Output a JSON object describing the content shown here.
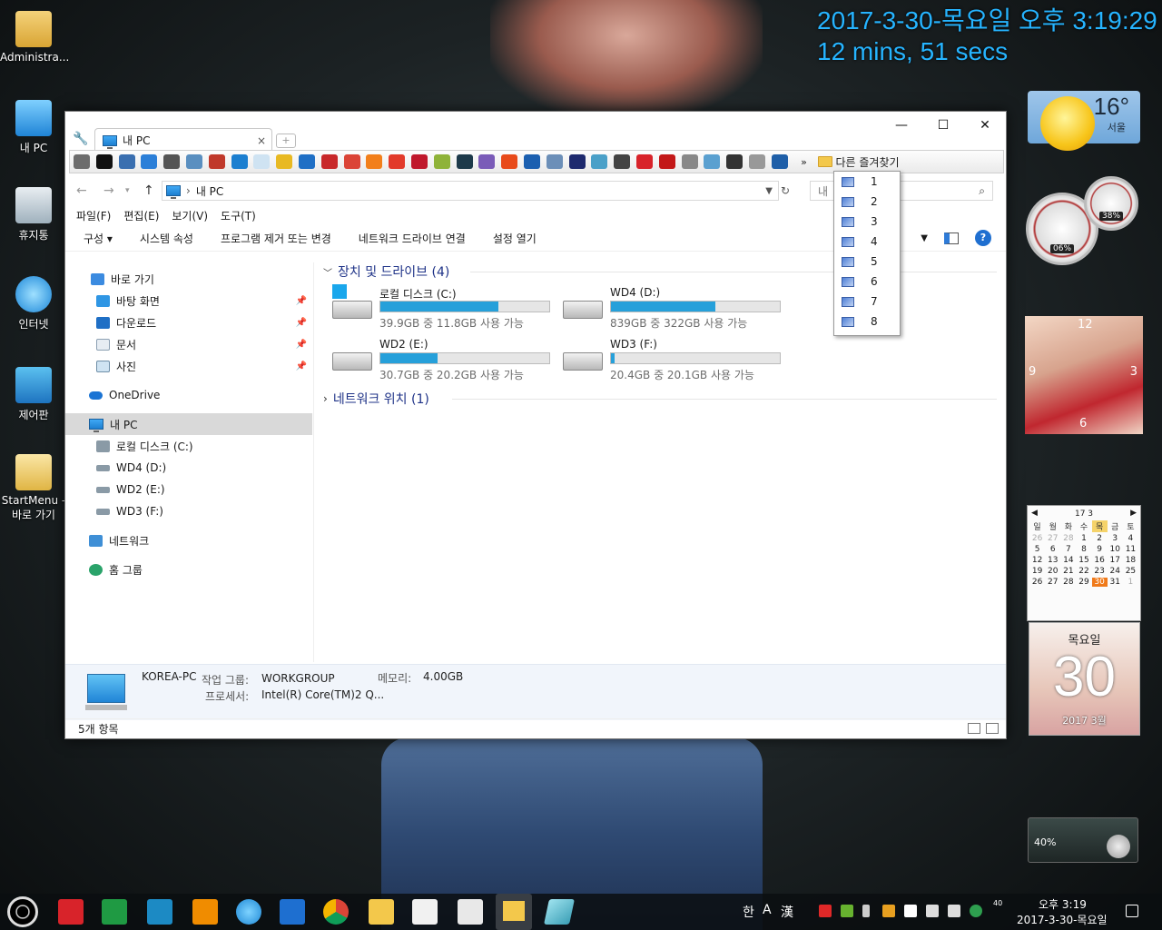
{
  "desktop": {
    "icons": [
      {
        "label": "Administra..."
      },
      {
        "label": "내 PC"
      },
      {
        "label": "휴지통"
      },
      {
        "label": "인터넷"
      },
      {
        "label": "제어판"
      },
      {
        "label": "StartMenu -"
      },
      {
        "label": "바로 가기"
      }
    ],
    "clock_line1": "2017-3-30-목요일 오후 3:19:29",
    "clock_line2": "12 mins, 51 secs"
  },
  "gadgets": {
    "weather": {
      "temp": "16°",
      "city": "서울"
    },
    "meters": {
      "cpu": "06%",
      "ram": "38%"
    },
    "photo_clock": {
      "n12": "12",
      "n3": "3",
      "n6": "6",
      "n9": "9"
    },
    "calendar": {
      "header": "17 3",
      "prev": "◀",
      "next": "▶",
      "weekdays": [
        "일",
        "월",
        "화",
        "수",
        "목",
        "금",
        "토"
      ],
      "days": [
        "26",
        "27",
        "28",
        "1",
        "2",
        "3",
        "4",
        "5",
        "6",
        "7",
        "8",
        "9",
        "10",
        "11",
        "12",
        "13",
        "14",
        "15",
        "16",
        "17",
        "18",
        "19",
        "20",
        "21",
        "22",
        "23",
        "24",
        "25",
        "26",
        "27",
        "28",
        "29",
        "30",
        "31",
        "1"
      ],
      "today": "30"
    },
    "date_card": {
      "weekday": "목요일",
      "day": "30",
      "yearmonth": "2017 3월"
    },
    "volume": {
      "percent": "40%"
    }
  },
  "window": {
    "tab_title": "내 PC",
    "tab_close": "×",
    "new_tab": "+",
    "controls": {
      "minimize": "—",
      "maximize": "☐",
      "close": "✕"
    },
    "overflow": "»",
    "favorites": "다른 즐겨찾기",
    "address": {
      "path": "내 PC",
      "search_placeholder": "내"
    },
    "menu": [
      "파일(F)",
      "편집(E)",
      "보기(V)",
      "도구(T)"
    ],
    "commands": [
      "구성 ▾",
      "시스템 속성",
      "프로그램 제거 또는 변경",
      "네트워크 드라이브 연결",
      "설정 열기"
    ],
    "nav": {
      "quick_access": "바로 가기",
      "desktop": "바탕 화면",
      "downloads": "다운로드",
      "documents": "문서",
      "pictures": "사진",
      "onedrive": "OneDrive",
      "this_pc": "내 PC",
      "drive_c": "로컬 디스크 (C:)",
      "drive_d": "WD4 (D:)",
      "drive_e": "WD2 (E:)",
      "drive_f": "WD3 (F:)",
      "network": "네트워크",
      "homegroup": "홈 그룹"
    },
    "content": {
      "devices_header": "장치 및 드라이브 (4)",
      "network_header": "네트워크 위치 (1)",
      "drives": [
        {
          "name": "로컬 디스크 (C:)",
          "free": "39.9GB 중 11.8GB 사용 가능",
          "used_fraction": 0.7
        },
        {
          "name": "WD4 (D:)",
          "free": "839GB 중 322GB 사용 가능",
          "used_fraction": 0.62
        },
        {
          "name": "WD2 (E:)",
          "free": "30.7GB 중 20.2GB 사용 가능",
          "used_fraction": 0.34
        },
        {
          "name": "WD3 (F:)",
          "free": "20.4GB 중 20.1GB 사용 가능",
          "used_fraction": 0.02
        }
      ]
    },
    "details": {
      "pc_name": "KOREA-PC",
      "workgroup_label": "작업 그룹:",
      "workgroup": "WORKGROUP",
      "memory_label": "메모리:",
      "memory": "4.00GB",
      "processor_label": "프로세서:",
      "processor": "Intel(R) Core(TM)2 Q..."
    },
    "status": "5개 항목",
    "dropdown": [
      "1",
      "2",
      "3",
      "4",
      "5",
      "6",
      "7",
      "8"
    ]
  },
  "taskbar": {
    "ime_han": "한",
    "ime_a": "A",
    "ime_hanja": "漢",
    "time": "오후 3:19",
    "date": "2017-3-30-목요일",
    "badge": "40"
  }
}
